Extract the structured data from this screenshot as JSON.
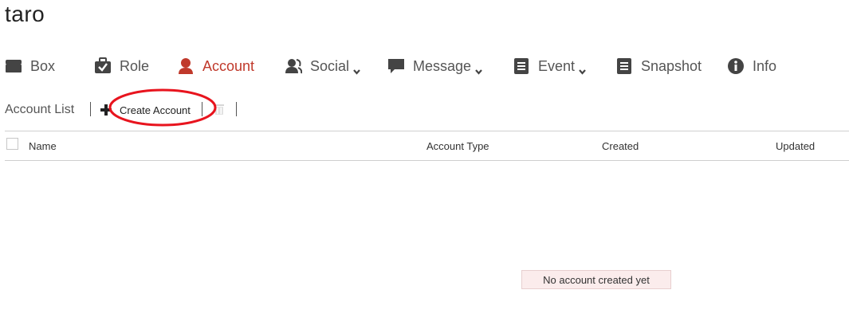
{
  "app_title": "taro",
  "nav": {
    "items": [
      {
        "label": "Box",
        "icon": "box-icon"
      },
      {
        "label": "Role",
        "icon": "role-badge-icon"
      },
      {
        "label": "Account",
        "icon": "user-icon"
      },
      {
        "label": "Social",
        "icon": "social-users-icon"
      },
      {
        "label": "Message",
        "icon": "message-bubble-icon"
      },
      {
        "label": "Event",
        "icon": "event-list-icon"
      },
      {
        "label": "Snapshot",
        "icon": "snapshot-icon"
      },
      {
        "label": "Info",
        "icon": "info-icon"
      }
    ],
    "active": "Account",
    "accent_color": "#c0392b"
  },
  "toolbar": {
    "section_label": "Account List",
    "create_label": "Create Account",
    "delete_icon": "trash-icon"
  },
  "table": {
    "columns": [
      "Name",
      "Account Type",
      "Created",
      "Updated"
    ],
    "rows": []
  },
  "empty_message": "No account created yet",
  "annotation_color": "#e8141e"
}
